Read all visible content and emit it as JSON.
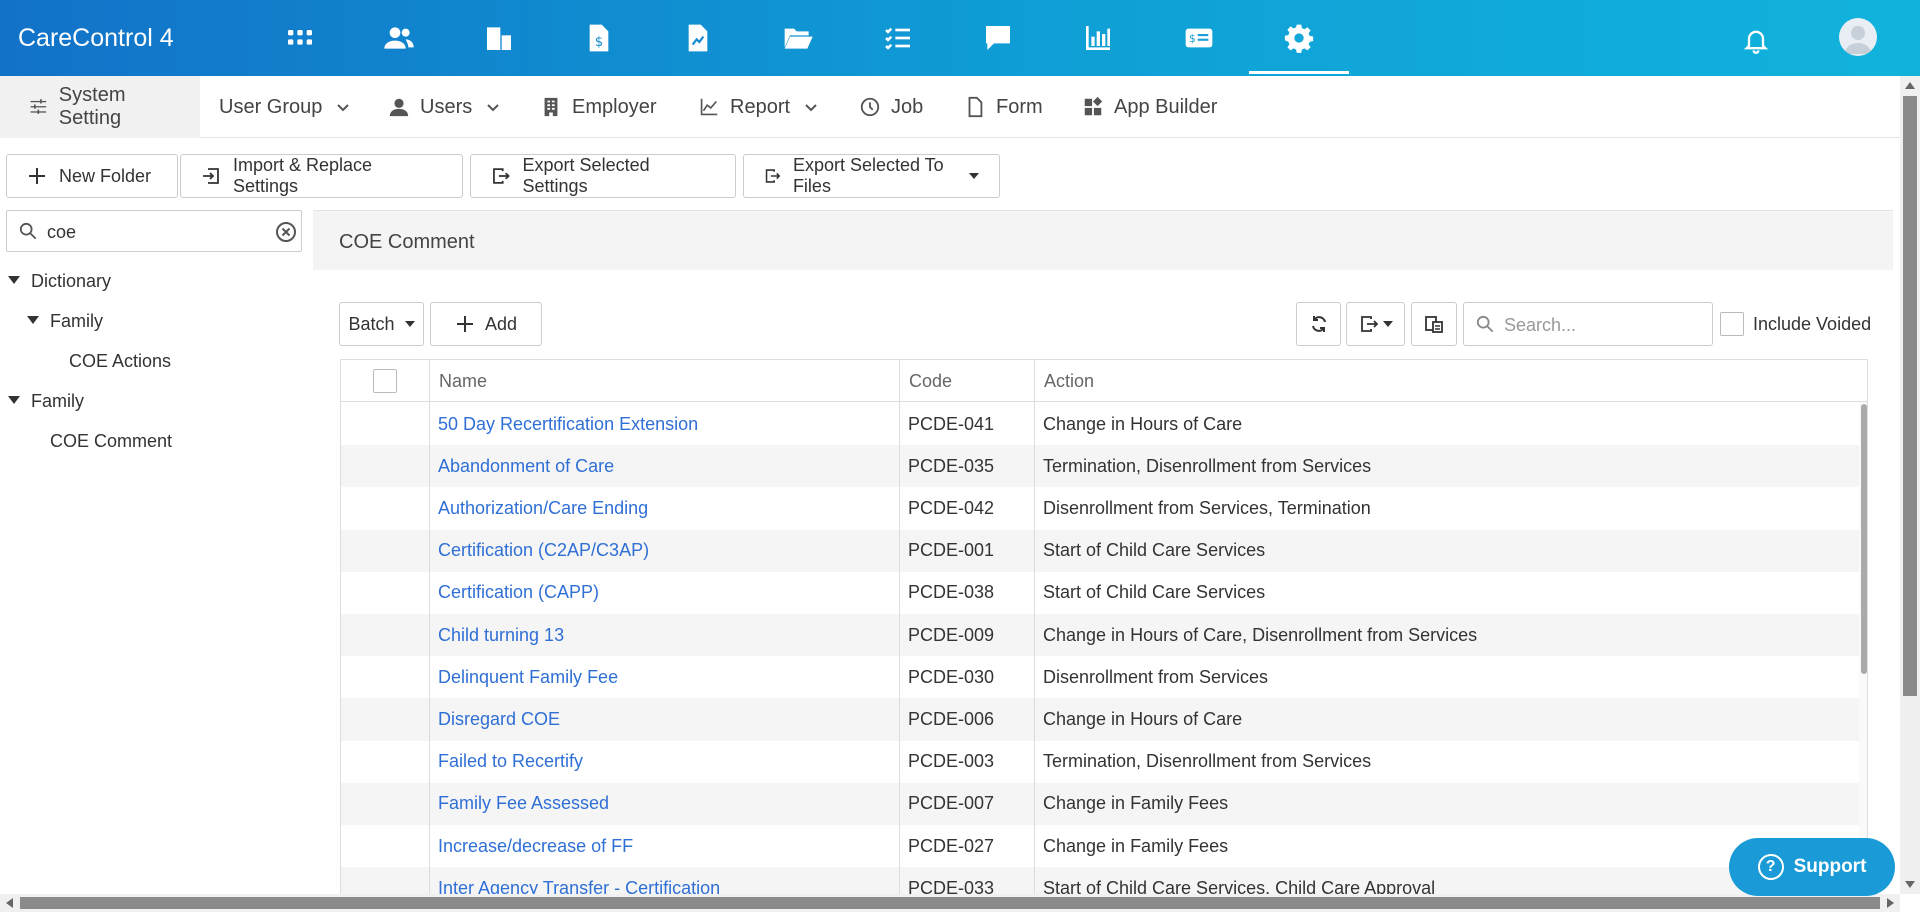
{
  "app": {
    "title": "CareControl 4"
  },
  "topnav": {
    "modules": [
      "apps-grid-icon",
      "people-icon",
      "building-icon",
      "billing-doc-icon",
      "report-doc-icon",
      "folder-open-icon",
      "checklist-icon",
      "chat-icon",
      "bar-chart-icon",
      "payment-card-icon",
      "gear-icon"
    ],
    "active": "gear-icon"
  },
  "subnav": {
    "system_setting": "System Setting",
    "user_group": "User Group",
    "users": "Users",
    "employer": "Employer",
    "report": "Report",
    "job": "Job",
    "form": "Form",
    "app_builder": "App Builder"
  },
  "toolbar": {
    "new_folder": "New Folder",
    "import_replace": "Import & Replace Settings",
    "export_selected": "Export Selected Settings",
    "export_files": "Export Selected To Files"
  },
  "tree_search": {
    "value": "coe"
  },
  "tree": {
    "dictionary": "Dictionary",
    "family_1": "Family",
    "coe_actions": "COE Actions",
    "family_2": "Family",
    "coe_comment": "COE Comment"
  },
  "panel": {
    "title": "COE Comment",
    "batch": "Batch",
    "add": "Add",
    "search_placeholder": "Search...",
    "include_voided": "Include Voided"
  },
  "grid": {
    "columns": [
      "Name",
      "Code",
      "Action"
    ],
    "rows": [
      {
        "name": "50 Day Recertification Extension",
        "code": "PCDE-041",
        "action": "Change in Hours of Care"
      },
      {
        "name": "Abandonment of Care",
        "code": "PCDE-035",
        "action": "Termination, Disenrollment from Services"
      },
      {
        "name": "Authorization/Care Ending",
        "code": "PCDE-042",
        "action": "Disenrollment from Services, Termination"
      },
      {
        "name": "Certification (C2AP/C3AP)",
        "code": "PCDE-001",
        "action": "Start of Child Care Services"
      },
      {
        "name": "Certification (CAPP)",
        "code": "PCDE-038",
        "action": "Start of Child Care Services"
      },
      {
        "name": "Child turning 13",
        "code": "PCDE-009",
        "action": "Change in Hours of Care, Disenrollment from Services"
      },
      {
        "name": "Delinquent Family Fee",
        "code": "PCDE-030",
        "action": "Disenrollment from Services"
      },
      {
        "name": "Disregard COE",
        "code": "PCDE-006",
        "action": "Change in Hours of Care"
      },
      {
        "name": "Failed to Recertify",
        "code": "PCDE-003",
        "action": "Termination, Disenrollment from Services"
      },
      {
        "name": "Family Fee Assessed",
        "code": "PCDE-007",
        "action": "Change in Family Fees"
      },
      {
        "name": "Increase/decrease of FF",
        "code": "PCDE-027",
        "action": "Change in Family Fees"
      },
      {
        "name": "Inter Agency Transfer - Certification",
        "code": "PCDE-033",
        "action": "Start of Child Care Services, Child Care Approval"
      }
    ]
  },
  "support": {
    "label": "Support"
  },
  "colors": {
    "topbar_start": "#1272c8",
    "topbar_end": "#11b3dc",
    "link": "#2f6fd6",
    "support": "#1a9ad6"
  }
}
